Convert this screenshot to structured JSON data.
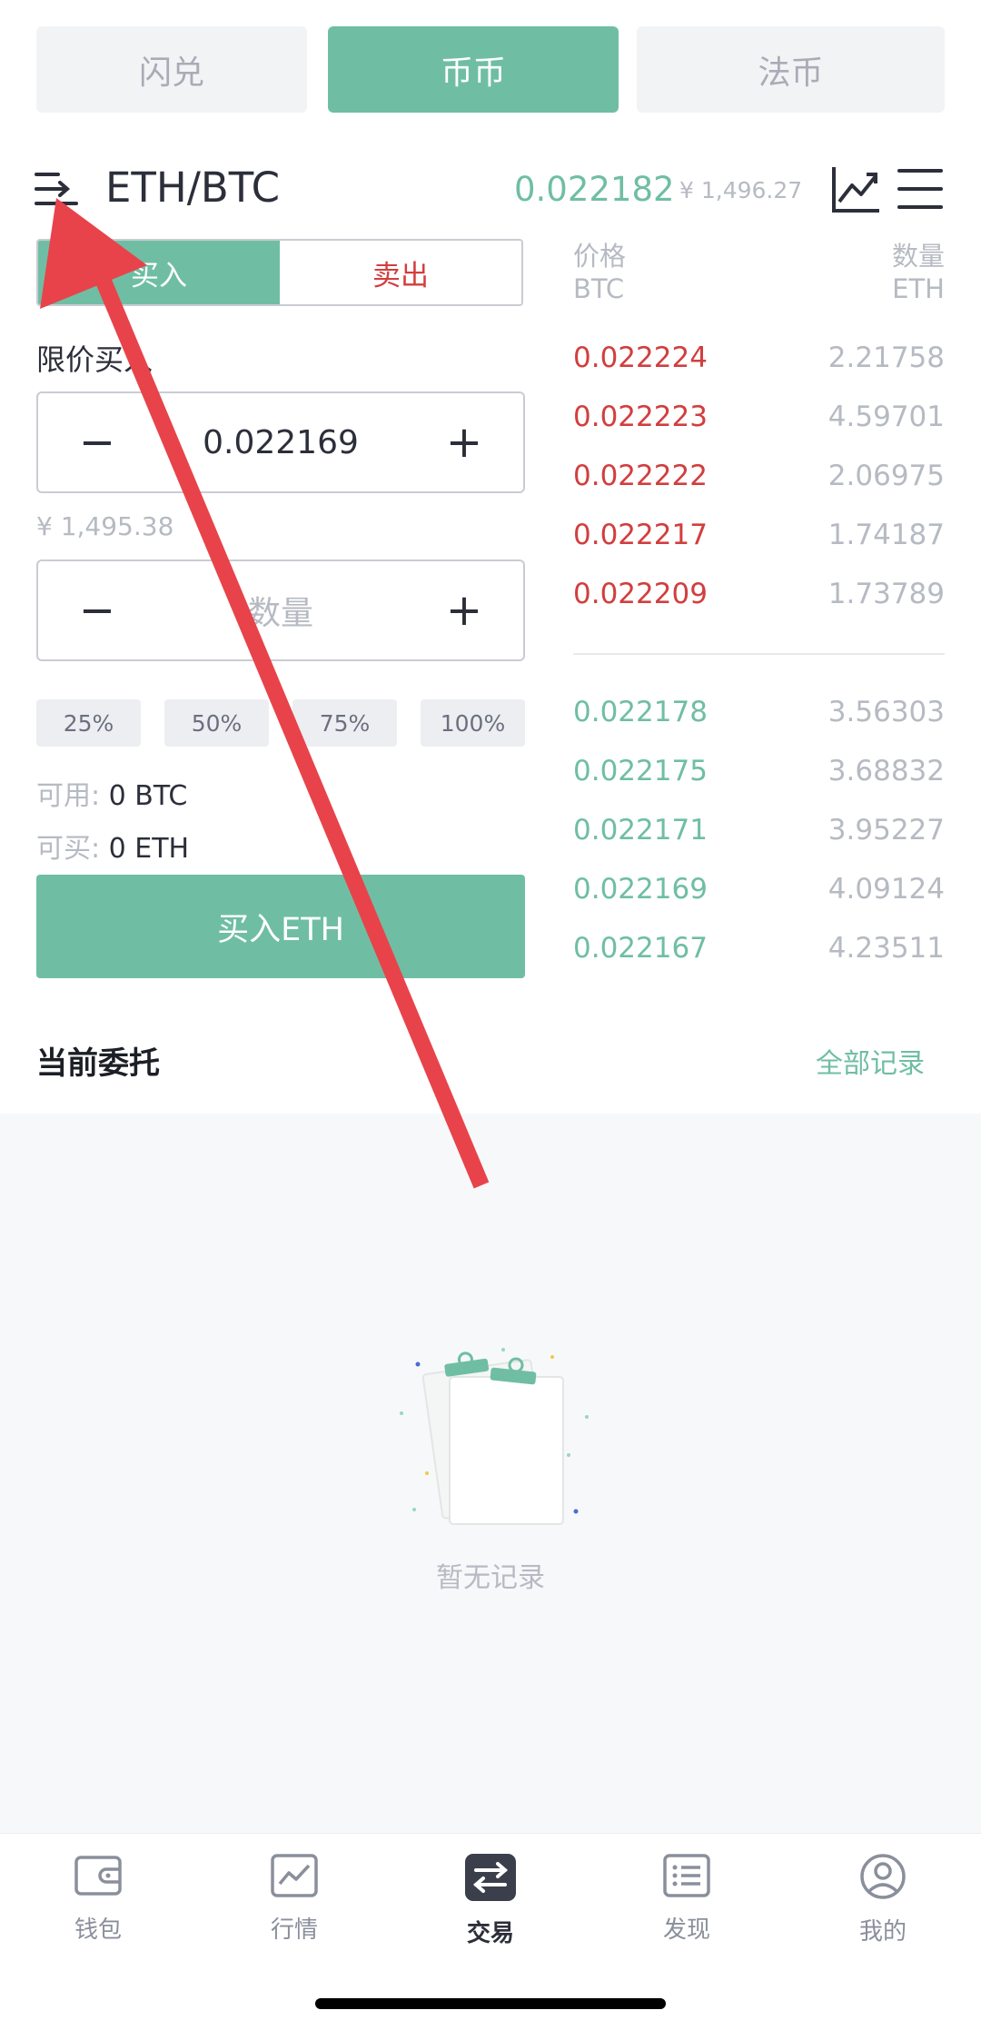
{
  "top_tabs": [
    "闪兑",
    "币币",
    "法币"
  ],
  "header": {
    "pair": "ETH/BTC",
    "last_price": "0.022182",
    "last_price_cny": "¥ 1,496.27",
    "icons": [
      "list-toggle-icon",
      "chart-icon",
      "menu-icon"
    ]
  },
  "trade": {
    "buy_label": "买入",
    "sell_label": "卖出",
    "order_type": "限价买入",
    "price_value": "0.022169",
    "price_cny": "¥ 1,495.38",
    "amount_placeholder": "数量",
    "percents": [
      "25%",
      "50%",
      "75%",
      "100%"
    ],
    "available_label": "可用:",
    "available_value": "0 BTC",
    "can_buy_label": "可买:",
    "can_buy_value": "0 ETH",
    "submit_label": "买入ETH"
  },
  "order_book": {
    "price_header": "价格",
    "price_unit": "BTC",
    "qty_header": "数量",
    "qty_unit": "ETH",
    "asks": [
      {
        "price": "0.022224",
        "qty": "2.21758"
      },
      {
        "price": "0.022223",
        "qty": "4.59701"
      },
      {
        "price": "0.022222",
        "qty": "2.06975"
      },
      {
        "price": "0.022217",
        "qty": "1.74187"
      },
      {
        "price": "0.022209",
        "qty": "1.73789"
      }
    ],
    "bids": [
      {
        "price": "0.022178",
        "qty": "3.56303"
      },
      {
        "price": "0.022175",
        "qty": "3.68832"
      },
      {
        "price": "0.022171",
        "qty": "3.95227"
      },
      {
        "price": "0.022169",
        "qty": "4.09124"
      },
      {
        "price": "0.022167",
        "qty": "4.23511"
      }
    ]
  },
  "orders": {
    "title": "当前委托",
    "all_records": "全部记录",
    "empty_text": "暂无记录"
  },
  "nav": [
    {
      "label": "钱包",
      "icon": "wallet-icon"
    },
    {
      "label": "行情",
      "icon": "market-icon"
    },
    {
      "label": "交易",
      "icon": "trade-icon"
    },
    {
      "label": "发现",
      "icon": "discover-icon"
    },
    {
      "label": "我的",
      "icon": "profile-icon"
    }
  ],
  "colors": {
    "accent": "#6fbea4",
    "sell": "#d23e3e",
    "annotation_arrow": "#e8434a"
  }
}
